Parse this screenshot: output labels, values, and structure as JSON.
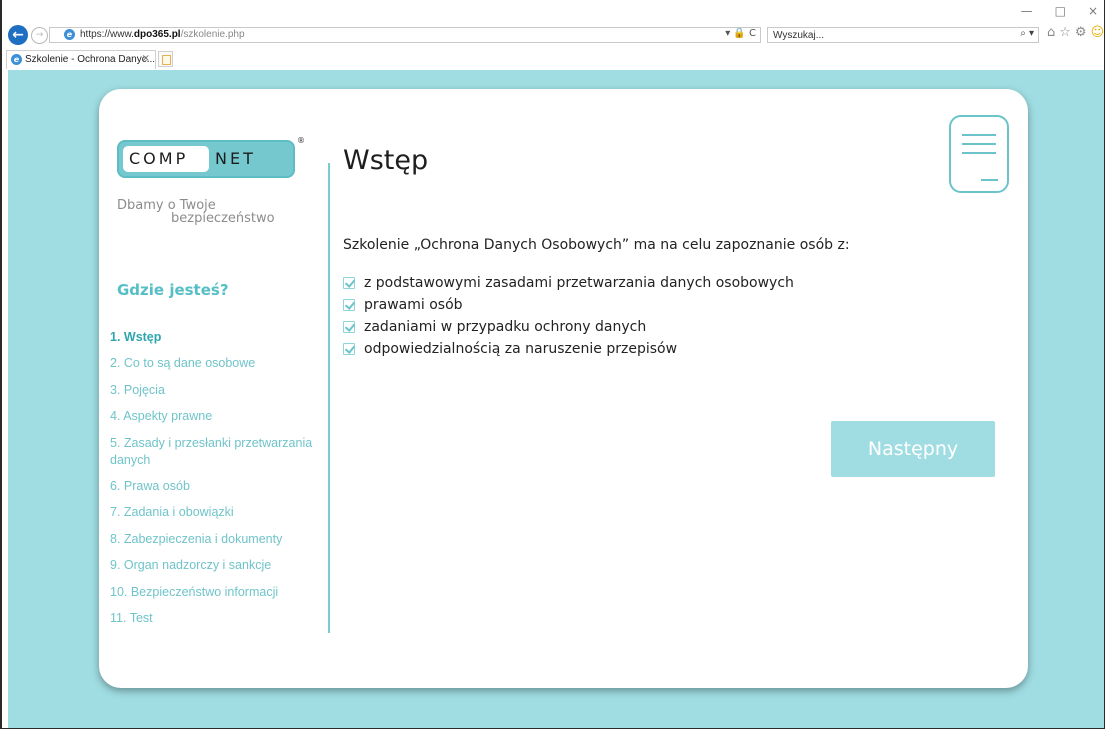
{
  "browser": {
    "url": {
      "protocol": "https://www.",
      "domain": "dpo365.pl",
      "path": "/szkolenie.php"
    },
    "address_right": "▾ 🔒 C",
    "search_placeholder": "Wyszukaj...",
    "search_button": "⌕ ▾",
    "tab_title": "Szkolenie - Ochrona Danyc...",
    "tab_close": "×",
    "window_controls": {
      "minimize": "—",
      "maximize": "□",
      "close": "×"
    },
    "toolbar_icons": {
      "home": "⌂",
      "favorites": "☆",
      "settings": "⚙",
      "feedback": "☺"
    }
  },
  "sidebar": {
    "logo_left": "COMP",
    "logo_right": "NET",
    "logo_registered": "®",
    "tagline_line1": "Dbamy o Twoje",
    "tagline_line2": "bezpieczeństwo",
    "where_label": "Gdzie jesteś?",
    "toc": [
      "1. Wstęp",
      "2. Co to są dane osobowe",
      "3. Pojęcia",
      "4. Aspekty prawne",
      "5. Zasady i przesłanki przetwarzania danych",
      "6. Prawa osób",
      "7. Zadania i obowiązki",
      "8. Zabezpieczenia i dokumenty",
      "9. Organ nadzorczy i sankcje",
      "10. Bezpieczeństwo informacji",
      "11. Test"
    ],
    "active_index": 0
  },
  "main": {
    "title": "Wstęp",
    "intro": "Szkolenie „Ochrona Danych Osobowych” ma na celu zapoznanie osób z:",
    "goals": [
      "z podstawowymi zasadami przetwarzania danych osobowych",
      "prawami osób",
      "zadaniami w przypadku ochrony danych",
      "odpowiedzialnością za naruszenie przepisów"
    ],
    "next_label": "Następny"
  },
  "colors": {
    "page_background": "#9fdde2",
    "accent": "#56bfc6",
    "toc_text": "#6fc4ca",
    "button": "#9fdde2"
  }
}
